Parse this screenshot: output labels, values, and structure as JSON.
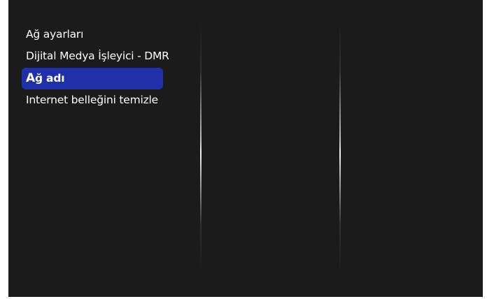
{
  "menu": {
    "items": [
      {
        "label": "Ağ ayarları"
      },
      {
        "label": "Dijital Medya İşleyici - DMR"
      },
      {
        "initial": "A",
        "rest": "ğ adı"
      },
      {
        "label": "Internet belleğini temizle"
      }
    ]
  },
  "colors": {
    "background": "#1b1b1b",
    "selection": "#2030a8",
    "text": "#ffffff"
  }
}
